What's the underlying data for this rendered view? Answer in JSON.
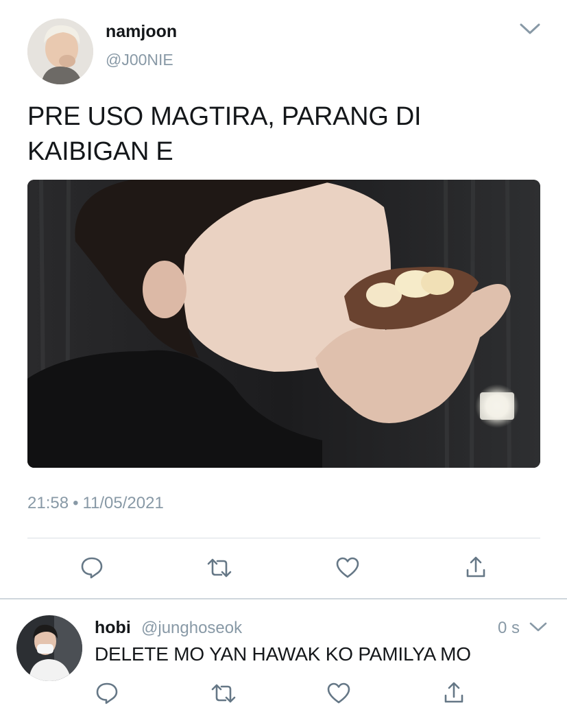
{
  "tweet": {
    "author_name": "namjoon",
    "author_handle": "@J00NIE",
    "text": "PRE USO MAGTIRA, PARANG DI KAIBIGAN E",
    "time": "21:58",
    "separator": "•",
    "date": "11/05/2021",
    "actions": [
      "reply-icon",
      "retweet-icon",
      "like-icon",
      "share-icon"
    ]
  },
  "reply": {
    "author_name": "hobi",
    "author_handle": "@junghoseok",
    "time": "0 s",
    "text": "DELETE MO YAN HAWAK KO PAMILYA MO",
    "actions": [
      "reply-icon",
      "retweet-icon",
      "like-icon",
      "share-icon"
    ]
  },
  "colors": {
    "text": "#14171a",
    "secondary": "#8899a6",
    "icon": "#657786",
    "divider": "#d9dfe4"
  }
}
